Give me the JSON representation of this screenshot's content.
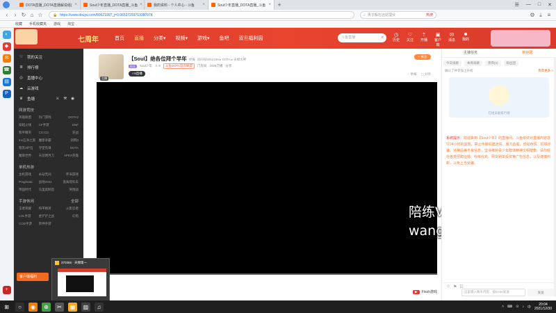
{
  "browser": {
    "tabs": [
      {
        "title": "DOTA直播_DOTA直播解说组(",
        "active": false
      },
      {
        "title": "Soul少年直播_DOTA直播_斗鱼",
        "active": false
      },
      {
        "title": "我的资料 - 个人中心 - 斗鱼",
        "active": false
      },
      {
        "title": "Soul少年直播_DOTA直播_斗鱼",
        "active": true
      }
    ],
    "new_tab": "+",
    "window_controls": [
      "☰",
      "—",
      "□",
      "✕"
    ],
    "url": "https://www.douyu.com/5062199?_j=0.06537293713380974",
    "search_placeholder": "男子躲在远处埋伏",
    "search_tag": "热搜",
    "bookmarks": [
      "收藏",
      "手机收藏夹",
      "游戏",
      "淘宝"
    ]
  },
  "header": {
    "brand": "七周年",
    "nav": [
      "首页",
      "直播",
      "分类▾",
      "视频▾",
      "游戏▾",
      "鱼吧",
      "双旦福利园"
    ],
    "active_nav": "直播",
    "search_placeholder": "斗鱼直播",
    "icons": [
      {
        "glyph": "◷",
        "label": "历史"
      },
      {
        "glyph": "♡",
        "label": "关注"
      },
      {
        "glyph": "⇡",
        "label": "开播"
      },
      {
        "glyph": "▣",
        "label": "客户端"
      },
      {
        "glyph": "✉",
        "label": "消息"
      },
      {
        "glyph": "☻",
        "label": "我的"
      }
    ]
  },
  "left_menu": {
    "items": [
      {
        "icon": "♡",
        "label": "我的关注"
      },
      {
        "icon": "≣",
        "label": "排行榜"
      },
      {
        "icon": "◎",
        "label": "直播中心"
      },
      {
        "icon": "☁",
        "label": "云游戏"
      }
    ],
    "row_label": "鱼塘",
    "sections": [
      {
        "title": "网游竞技",
        "more": "",
        "items": [
          "英雄联盟",
          "热门游戏",
          "DOTA2",
          "穿越火线",
          "CF手游",
          "DNF",
          "和平精英",
          "CS:GO",
          "逆战",
          "Ins五洋之旅",
          "魔兽争霸",
          "剑网3",
          "暗黑3炉石",
          "守望先锋",
          "DOTA",
          "魔兽世界",
          "天涯明月刀",
          "APEX英雄"
        ]
      },
      {
        "title": "单机热游",
        "more": "",
        "items": [
          "主机游戏",
          "永劫无间",
          "怀旧游戏",
          "Pragmatic",
          "战地2042",
          "逃离塔科夫",
          "帝国时代",
          "马里奥制造",
          "突围战"
        ]
      },
      {
        "title": "手游休闲",
        "more": "全部",
        "items": [
          "王者荣耀",
          "和平精英",
          "火影忍者",
          "LOL手游",
          "金铲铲之战",
          "幻塔",
          "COD手游",
          "原神手游",
          ""
        ]
      }
    ],
    "footer_btn": "客户端福利"
  },
  "room": {
    "title": "【Soul】绝各位拜个早年",
    "title_suffix": "举报",
    "room_meta": "房间号5062199 ▸ DOTA ▸ 天梯大神",
    "tags": [
      "D11",
      "Soul少年",
      "♙ 8",
      "斗鱼DOTA官方联盟",
      "门房间",
      "1025万播",
      "分享"
    ],
    "hot_label": "☆5直播",
    "follow_btn": "+ 关注",
    "right_info": [
      "♡ 举报",
      "▢ 分享"
    ],
    "avatar_level": "主播"
  },
  "player": {
    "flash_label": "Flash游戏",
    "flash_btn": "▶",
    "watermark_line1": "陪练V：soul12zxy",
    "watermark_line2": "wangyunuo.xy"
  },
  "chat": {
    "tabs": [
      "主播任务",
      "粉丝团"
    ],
    "rank_tabs": [
      "今日贡献",
      "本周贡献",
      "贵宾(0)",
      "粉丝团"
    ],
    "rank_more": "贵宾更多 >",
    "subline": "确认了并参加上升榜",
    "rank_caption": "在线贡献排行榜",
    "system_label": "系统提示：",
    "system_msg": "欢迎来到【Soul少年】的直播间。斗鱼依法对直播内容进行24小时的监督，禁止传播封建迷信、暴力血腥、低俗色情、招嫖诈骗、违禁品等不良信息，坚决维护青少年群体精神文明健康。请勿轻信各类招聘征婚、代练代充、网贷刷单投资等广告信息，以及谨慎判断，以免上当受骗。",
    "input_placeholder": "这里输入聊天内容，按Enter发送",
    "send_btn": "发送",
    "tools": [
      "☺",
      "⚑",
      "☷"
    ]
  },
  "preview": {
    "title": "370366 · 天梯第一"
  },
  "taskbar": {
    "apps": [
      "⊞",
      "○",
      "◉",
      "⊕",
      "✂",
      "▦",
      "▥",
      "♫"
    ],
    "tray": [
      "˄",
      "⌨",
      "⊙",
      "♪",
      "中"
    ],
    "time": "20:04",
    "date": "2021/12/30"
  },
  "colors": {
    "douyu_red": "#d93a2b",
    "accent_orange": "#ff6a00",
    "player_black": "#000000"
  }
}
